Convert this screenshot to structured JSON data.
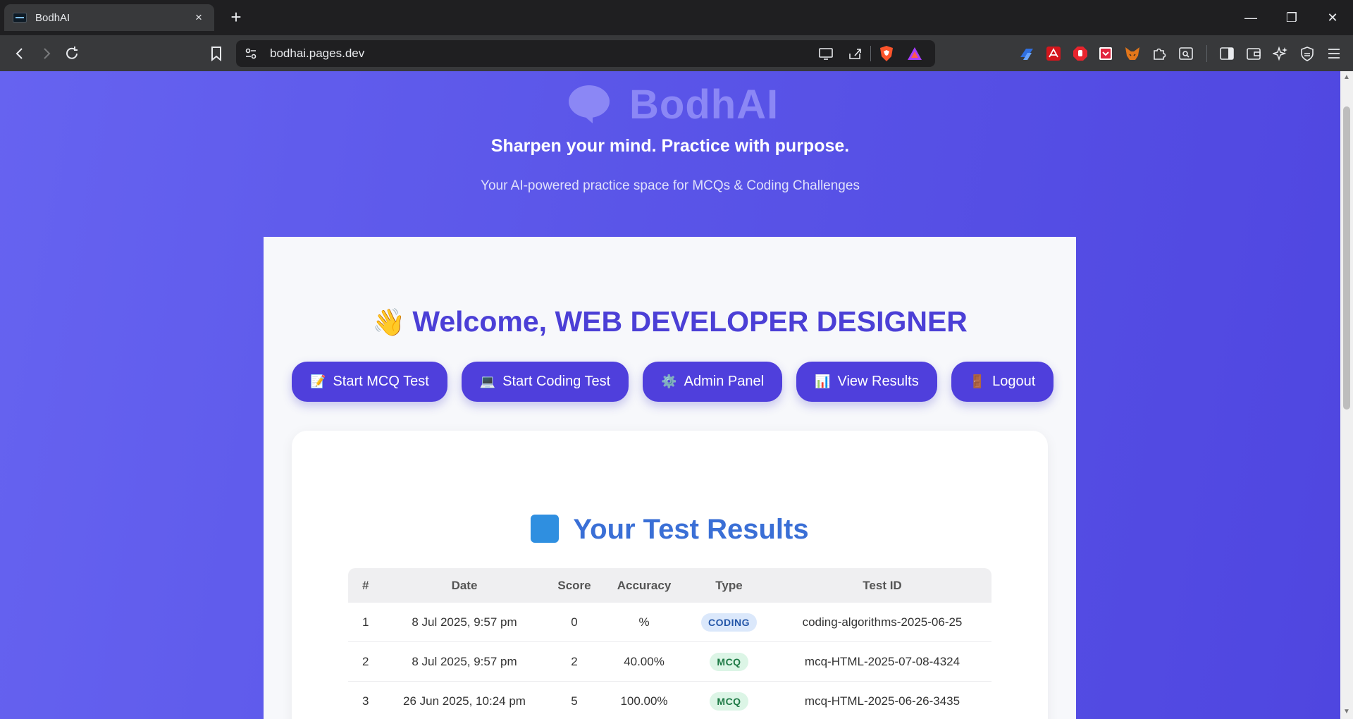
{
  "browser": {
    "tab_title": "BodhAI",
    "tab_close": "×",
    "new_tab": "+",
    "url": "bodhai.pages.dev",
    "window_controls": {
      "minimize": "—",
      "restore": "❐",
      "close": "✕"
    }
  },
  "page": {
    "logo_text": "BodhAI",
    "tagline": "Sharpen your mind. Practice with purpose.",
    "subtagline": "Your AI-powered practice space for MCQs & Coding Challenges",
    "welcome_hand": "👋",
    "welcome_text": "Welcome, WEB DEVELOPER DESIGNER",
    "actions": [
      {
        "icon": "📝",
        "label": "Start MCQ Test"
      },
      {
        "icon": "💻",
        "label": "Start Coding Test"
      },
      {
        "icon": "⚙️",
        "label": "Admin Panel"
      },
      {
        "icon": "📊",
        "label": "View Results"
      },
      {
        "icon": "🚪",
        "label": "Logout"
      }
    ],
    "results": {
      "title": "Your Test Results",
      "columns": [
        "#",
        "Date",
        "Score",
        "Accuracy",
        "Type",
        "Test ID"
      ],
      "rows": [
        {
          "n": "1",
          "date": "8 Jul 2025, 9:57 pm",
          "score": "0",
          "accuracy": "%",
          "type": "CODING",
          "test_id": "coding-algorithms-2025-06-25"
        },
        {
          "n": "2",
          "date": "8 Jul 2025, 9:57 pm",
          "score": "2",
          "accuracy": "40.00%",
          "type": "MCQ",
          "test_id": "mcq-HTML-2025-07-08-4324"
        },
        {
          "n": "3",
          "date": "26 Jun 2025, 10:24 pm",
          "score": "5",
          "accuracy": "100.00%",
          "type": "MCQ",
          "test_id": "mcq-HTML-2025-06-26-3435"
        }
      ]
    }
  },
  "colors": {
    "accent": "#4f3fdc",
    "welcome": "#4b3fd6",
    "results_title": "#3a6fd6",
    "coding_badge": "#dbe8fb",
    "mcq_badge": "#dcf5e6"
  }
}
